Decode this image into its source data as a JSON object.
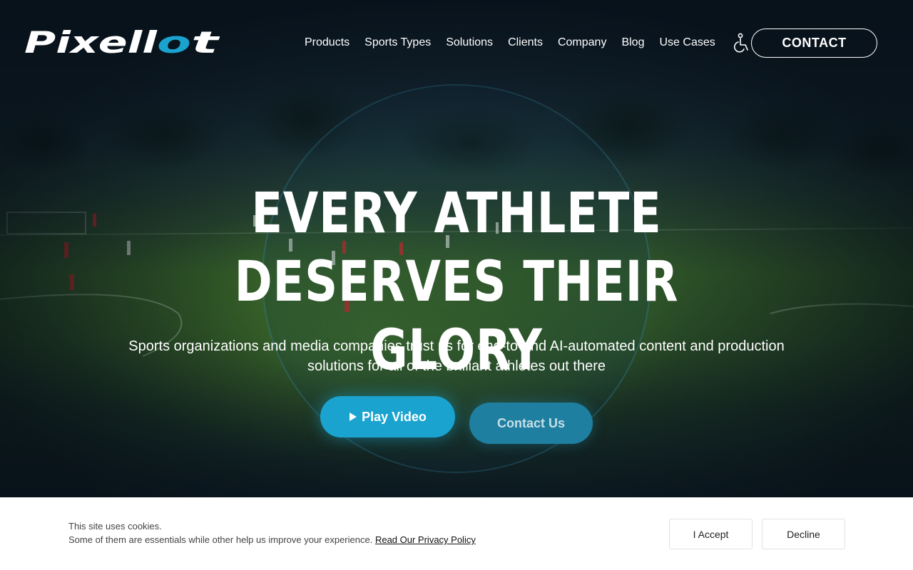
{
  "brand": {
    "logo_text": "Pixellot",
    "accent_color": "#1aa3cf"
  },
  "nav": {
    "items": [
      "Products",
      "Sports Types",
      "Solutions",
      "Clients",
      "Company",
      "Blog",
      "Use Cases"
    ],
    "accessibility_icon": "wheelchair-icon",
    "contact_label": "CONTACT"
  },
  "hero": {
    "headline_line1": "EVERY ATHLETE DESERVES THEIR",
    "headline_line2": "GLORY",
    "subhead": "Sports organizations and media companies trust us for end-to-end AI-automated content and production solutions for all of the brilliant athletes out there",
    "play_video_label": "Play Video",
    "play_icon": "play-icon",
    "contact_us_label": "Contact Us"
  },
  "cookie": {
    "line1": "This site uses cookies.",
    "line2": "Some of them are essentials while other help us improve your experience.",
    "policy_link": "Read Our Privacy Policy",
    "accept_label": "I Accept",
    "decline_label": "Decline"
  }
}
